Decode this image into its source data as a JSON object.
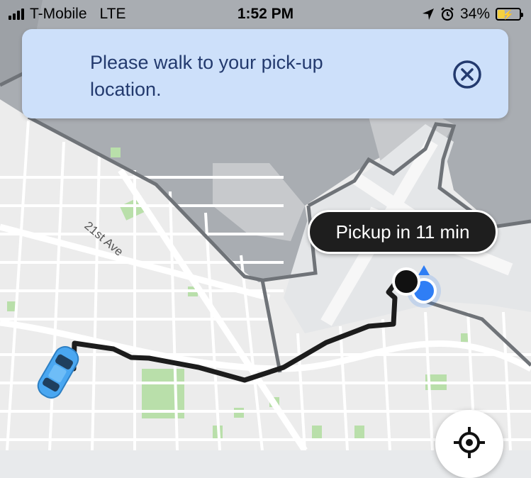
{
  "status_bar": {
    "carrier": "T-Mobile",
    "network": "LTE",
    "time": "1:52 PM",
    "battery": "34%",
    "battery_level": 0.34,
    "icons": [
      "signal-bars-icon",
      "location-arrow-icon",
      "alarm-clock-icon",
      "battery-charging-icon"
    ]
  },
  "banner": {
    "message": "Please walk to your pick-up location.",
    "walk_icon": "walking-person-icon",
    "close_icon": "close-circle-icon"
  },
  "map": {
    "street_label": "21st Ave",
    "pickup_tooltip": "Pickup in 11 min",
    "markers": [
      "car-icon",
      "pickup-pin-icon",
      "current-location-dot-icon"
    ],
    "colors": {
      "water": "#a9adb2",
      "land": "#ececec",
      "park": "#b9dfaa",
      "route": "#1c1c1c",
      "boundary": "#6f7378",
      "location_dot": "#2f7ef5",
      "car": "#4aa7f1"
    }
  },
  "controls": {
    "recenter_icon": "crosshair-location-icon"
  }
}
